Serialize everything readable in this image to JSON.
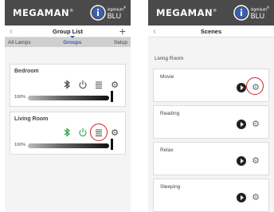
{
  "left_screen": {
    "brand": "MEGAMAN",
    "brand_mark": "®",
    "logo_small": "ingenium",
    "logo_small_mark": "®",
    "logo_big": "BLU",
    "title": "Group List",
    "back_icon": "chevron-left-icon",
    "add_icon": "plus-icon",
    "tabs": [
      "All Lamps",
      "Groups",
      "Setup"
    ],
    "active_tab": "Groups",
    "groups": [
      {
        "name": "Bedroom",
        "brightness": "100%",
        "brightness_level": 1.0,
        "bluetooth_color": "#444444",
        "power_color": "#444444"
      },
      {
        "name": "Living Room",
        "brightness": "100%",
        "brightness_level": 1.0,
        "bluetooth_color": "#27a243",
        "power_color": "#27a243",
        "highlighted_icon": "list-icon"
      }
    ]
  },
  "right_screen": {
    "brand": "MEGAMAN",
    "brand_mark": "®",
    "logo_small": "ingenium",
    "logo_small_mark": "®",
    "logo_big": "BLU",
    "title": "Scenes",
    "back_icon": "chevron-left-icon",
    "section": "Living Room",
    "scenes": [
      {
        "name": "Movie",
        "highlighted_icon": "gear-icon"
      },
      {
        "name": "Reading"
      },
      {
        "name": "Relax"
      },
      {
        "name": "Sleeping"
      }
    ]
  },
  "colors": {
    "header": "#4a4a4a",
    "accent": "#3a5fb0",
    "highlight": "#d32020",
    "green": "#27a243"
  }
}
